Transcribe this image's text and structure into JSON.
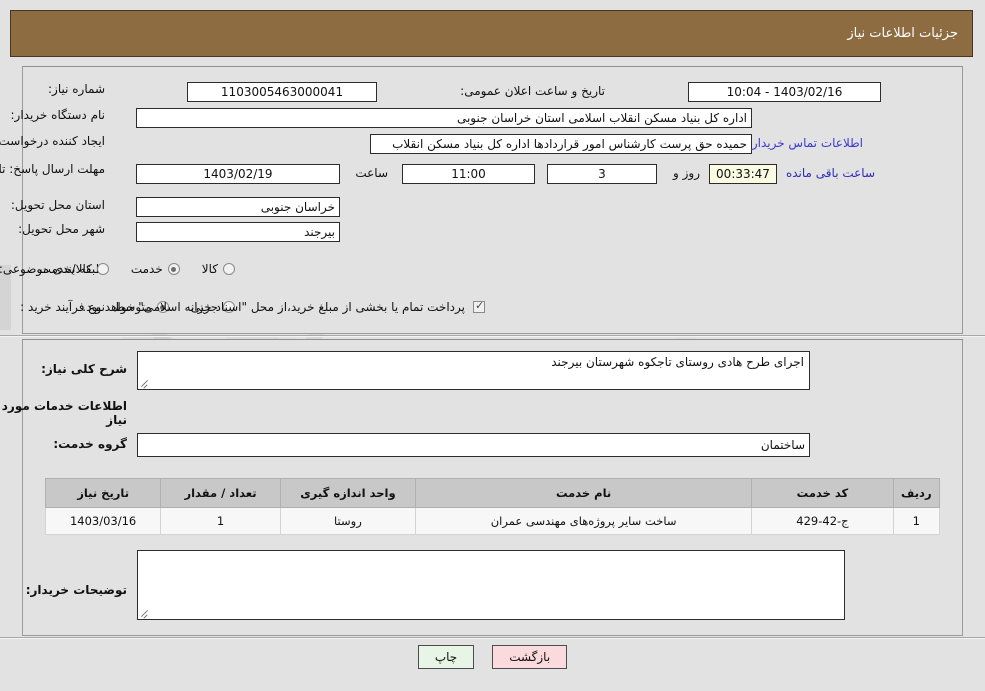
{
  "header": {
    "title": "جزئیات اطلاعات نیاز"
  },
  "colors": {
    "header_bg": "#8d6c41",
    "page_bg": "#e2e2e2",
    "link": "#3a3acd",
    "table_header_bg": "#c8c8c8",
    "timer_bg": "#fbfbe3",
    "btn_back_bg": "#fadadd",
    "btn_print_bg": "#e6f5e6"
  },
  "top_panel": {
    "need_number": {
      "label": "شماره نیاز:",
      "value": "1103005463000041"
    },
    "announcement_datetime": {
      "label": "تاریخ و ساعت اعلان عمومی:",
      "value": "1403/02/16 - 10:04"
    },
    "buyer_org": {
      "label": "نام دستگاه خریدار:",
      "value": "اداره کل بنیاد مسکن انقلاب اسلامی استان خراسان جنوبی"
    },
    "request_creator": {
      "label": "ایجاد کننده درخواست:",
      "value": "حمیده حق پرست کارشناس امور قراردادها اداره کل بنیاد مسکن انقلاب اسلامی",
      "contact_link": "اطلاعات تماس خریدار"
    },
    "response_deadline": {
      "label": "مهلت ارسال پاسخ: تا تاریخ:",
      "date_value": "1403/02/19",
      "time_label": "ساعت",
      "time_value": "11:00",
      "days_value": "3",
      "days_suffix": "روز و",
      "countdown_value": "00:33:47",
      "countdown_suffix": "ساعت باقی مانده"
    },
    "delivery_province": {
      "label": "استان محل تحویل:",
      "value": "خراسان جنوبی"
    },
    "delivery_city": {
      "label": "شهر محل تحویل:",
      "value": "بیرجند"
    },
    "subject_category": {
      "label": "طبقه بندی موضوعی:",
      "options": [
        {
          "label": "کالا",
          "selected": false
        },
        {
          "label": "خدمت",
          "selected": true
        },
        {
          "label": "کالا/خدمت",
          "selected": false
        }
      ]
    },
    "purchase_process": {
      "label": "نوع فرآیند خرید :",
      "options": [
        {
          "label": "جزیی",
          "selected": false
        },
        {
          "label": "متوسط",
          "selected": true
        }
      ],
      "checkbox_checked": true,
      "checkbox_note": "پرداخت تمام یا بخشی از مبلغ خرید،از محل \"اسناد خزانه اسلامی\" خواهد بود."
    }
  },
  "mid_panel": {
    "general_description": {
      "label": "شرح کلی نیاز:",
      "value": "اجرای طرح هادی روستای تاجکوه شهرستان بیرجند"
    },
    "services_section_heading": "اطلاعات خدمات مورد نیاز",
    "service_group": {
      "label": "گروه خدمت:",
      "value": "ساختمان"
    },
    "items_table": {
      "columns": [
        "ردیف",
        "کد خدمت",
        "نام خدمت",
        "واحد اندازه گیری",
        "تعداد / مقدار",
        "تاریخ نیاز"
      ],
      "rows": [
        {
          "row_no": "1",
          "service_code": "ج-42-429",
          "service_name": "ساخت سایر پروژه‌های مهندسی عمران",
          "unit": "روستا",
          "quantity": "1",
          "need_date": "1403/03/16"
        }
      ]
    },
    "buyer_notes": {
      "label": "توضیحات خریدار:",
      "value": ""
    }
  },
  "footer": {
    "back_button": "بازگشت",
    "print_button": "چاپ"
  }
}
